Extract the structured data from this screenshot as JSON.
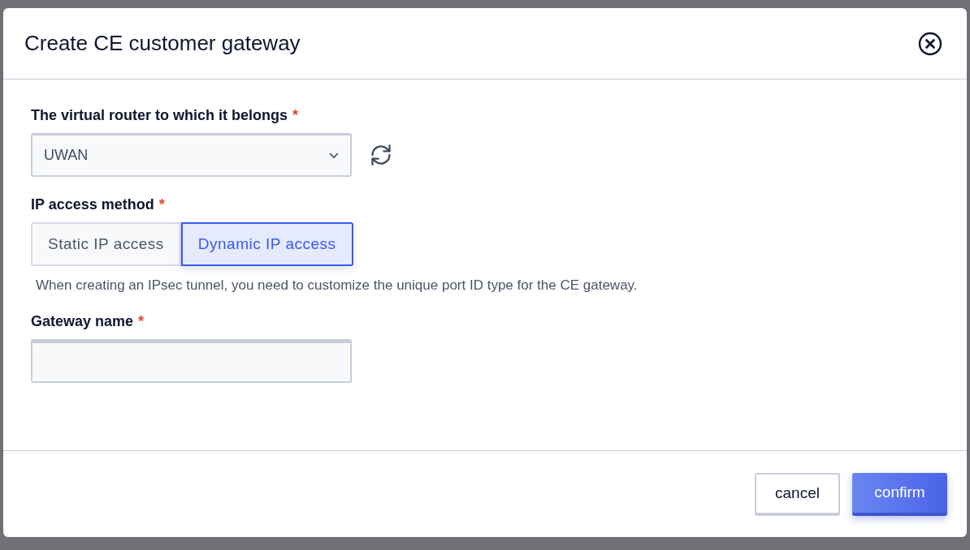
{
  "dialog": {
    "title": "Create CE customer gateway"
  },
  "fields": [
    {
      "kind": "select",
      "label": "The virtual router to which it belongs",
      "required_mark": "*",
      "value": "UWAN"
    },
    {
      "kind": "segmented",
      "label": "IP access method",
      "required_mark": "*",
      "options": [
        {
          "label": "Static IP access",
          "selected": false
        },
        {
          "label": "Dynamic IP access",
          "selected": true
        }
      ],
      "hint": "When creating an IPsec tunnel, you need to customize the unique port ID type for the CE gateway."
    },
    {
      "kind": "text",
      "label": "Gateway name",
      "required_mark": "*"
    }
  ],
  "buttons": [
    {
      "label": "cancel",
      "kind": "secondary"
    },
    {
      "label": "confirm",
      "kind": "primary"
    }
  ]
}
